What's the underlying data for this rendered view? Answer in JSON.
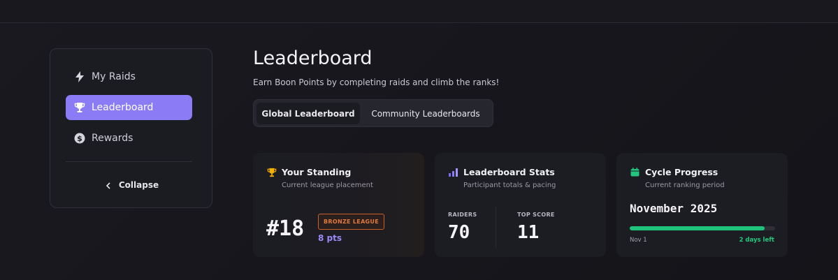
{
  "sidebar": {
    "items": [
      {
        "label": "My Raids",
        "icon": "lightning-icon",
        "active": false
      },
      {
        "label": "Leaderboard",
        "icon": "trophy-icon",
        "active": true
      },
      {
        "label": "Rewards",
        "icon": "dollar-coin-icon",
        "active": false
      }
    ],
    "collapse_label": "Collapse"
  },
  "header": {
    "title": "Leaderboard",
    "subtitle": "Earn Boon Points by completing raids and climb the ranks!"
  },
  "tabs": [
    {
      "label": "Global Leaderboard",
      "active": true
    },
    {
      "label": "Community Leaderboards",
      "active": false
    }
  ],
  "cards": {
    "standing": {
      "title": "Your Standing",
      "subtitle": "Current league placement",
      "icon": "trophy-icon",
      "rank": "#18",
      "league": "BRONZE LEAGUE",
      "points": "8 pts"
    },
    "stats": {
      "title": "Leaderboard Stats",
      "subtitle": "Participant totals & pacing",
      "icon": "bar-chart-icon",
      "raiders_label": "RAIDERS",
      "raiders_value": "70",
      "top_score_label": "TOP SCORE",
      "top_score_value": "11"
    },
    "cycle": {
      "title": "Cycle Progress",
      "subtitle": "Current ranking period",
      "icon": "calendar-icon",
      "period": "November 2025",
      "progress_fraction": 0.93,
      "start_label": "Nov 1",
      "remaining_label": "2 days left"
    }
  },
  "colors": {
    "accent": "#8b7cf5",
    "bronze": "#e07a3d",
    "success": "#22c77d",
    "trophy": "#f5b100"
  }
}
